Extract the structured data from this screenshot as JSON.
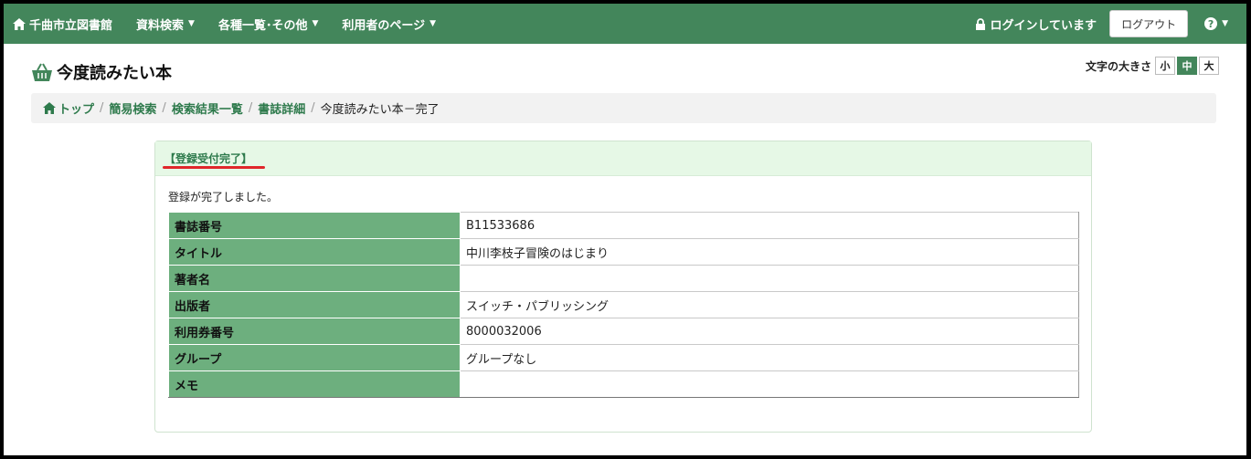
{
  "navbar": {
    "brand": "千曲市立図書館",
    "menus": [
      "資料検索",
      "各種一覧･その他",
      "利用者のページ"
    ],
    "login_status": "ログインしています",
    "logout_label": "ログアウト",
    "help_label": "?"
  },
  "page": {
    "title": "今度読みたい本",
    "font_size_label": "文字の大きさ",
    "font_sizes": [
      "小",
      "中",
      "大"
    ],
    "font_size_selected": "中"
  },
  "breadcrumb": {
    "items": [
      "トップ",
      "簡易検索",
      "検索結果一覧",
      "書誌詳細"
    ],
    "current": "今度読みたい本－完了"
  },
  "panel": {
    "title": "【登録受付完了】",
    "message": "登録が完了しました。",
    "rows": [
      {
        "label": "書誌番号",
        "value": "B11533686"
      },
      {
        "label": "タイトル",
        "value": "中川李枝子冒険のはじまり"
      },
      {
        "label": "著者名",
        "value": ""
      },
      {
        "label": "出版者",
        "value": "スイッチ・パブリッシング"
      },
      {
        "label": "利用券番号",
        "value": "8000032006"
      },
      {
        "label": "グループ",
        "value": "グループなし"
      },
      {
        "label": "メモ",
        "value": ""
      }
    ]
  },
  "colors": {
    "navbar": "#43865b",
    "table_header": "#6daf7e",
    "panel_heading": "#e6f8e6",
    "link": "#2e7a4c",
    "underline": "#e0262b"
  },
  "icons": {
    "brand": "home-icon",
    "page_title": "basket-icon",
    "login": "lock-icon",
    "help": "question-circle-icon",
    "breadcrumb_home": "home-icon"
  }
}
